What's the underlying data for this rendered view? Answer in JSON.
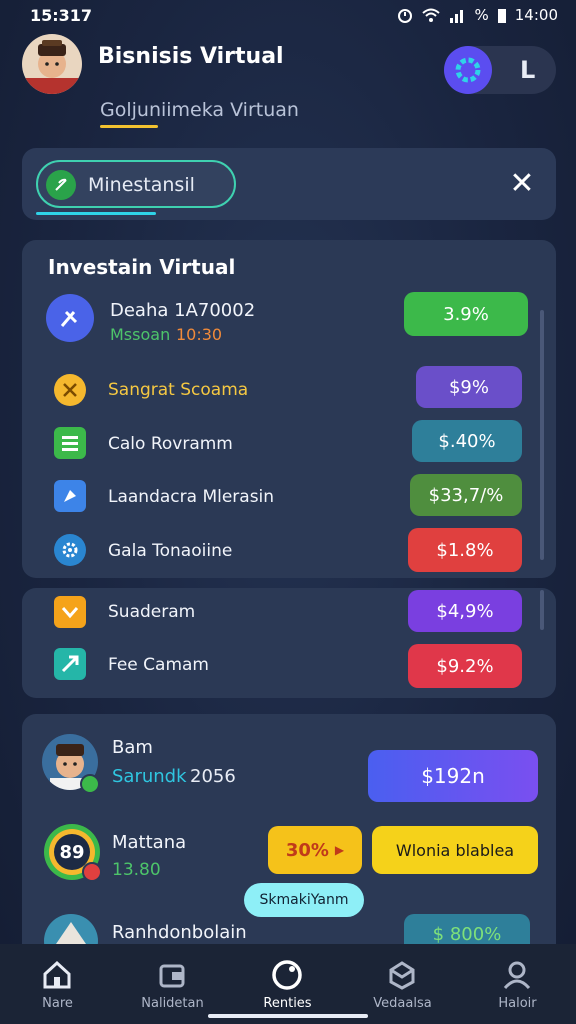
{
  "status_bar": {
    "time": "15:317",
    "battery": "%",
    "clock_right": "14:00"
  },
  "header": {
    "title": "Bisnisis Virtual",
    "subtitle": "Goljuniimeka Virtuan",
    "toggle_label": "L"
  },
  "search": {
    "value": "Minestansil"
  },
  "invest_card": {
    "title": "Investain Virtual",
    "featured": {
      "name": "Deaha 1A70002",
      "sub_label": "Mssoan",
      "sub_value": "10:30",
      "badge": "3.9%",
      "badge_color": "#3cb94a"
    },
    "items": [
      {
        "label": "Sangrat Scoama",
        "value": "$9%",
        "icon": "coin-icon",
        "label_color": "#f5c842",
        "pill_color": "#6a4fc9"
      },
      {
        "label": "Calo Rovramm",
        "value": "$.40%",
        "icon": "list-icon",
        "label_color": "#f1f4fa",
        "pill_color": "#2e7f9a"
      },
      {
        "label": "Laandacra Mlerasin",
        "value": "$33,7/%",
        "icon": "rocket-icon",
        "label_color": "#f1f4fa",
        "pill_color": "#4f8e3e"
      },
      {
        "label": "Gala Tonaoiine",
        "value": "$1.8%",
        "icon": "gear-icon",
        "label_color": "#f1f4fa",
        "pill_color": "#e0403f"
      },
      {
        "label": "Suaderam",
        "value": "$4,9%",
        "icon": "check-icon",
        "label_color": "#f1f4fa",
        "pill_color": "#7a3fe0"
      },
      {
        "label": "Fee Camam",
        "value": "$9.2%",
        "icon": "arrow-icon",
        "label_color": "#f1f4fa",
        "pill_color": "#e0374a"
      }
    ]
  },
  "bottom_list": {
    "items": [
      {
        "title": "Bam",
        "sub_label": "Sarundk",
        "sub_value": "2056",
        "button": "$192n"
      },
      {
        "title": "Mattana",
        "sub_value": "13.80",
        "avatar_text": "89",
        "pct_button": "30%",
        "action_button": "Wlonia blablea"
      },
      {
        "title": "Ranhdonbolain",
        "value": "$ 800%"
      }
    ],
    "tooltip": "SkmakiYanm"
  },
  "nav": {
    "items": [
      {
        "label": "Nare",
        "icon": "home-icon"
      },
      {
        "label": "Nalidetan",
        "icon": "wallet-icon"
      },
      {
        "label": "Renties",
        "icon": "circle-icon"
      },
      {
        "label": "Vedaalsa",
        "icon": "box-icon"
      },
      {
        "label": "Haloir",
        "icon": "user-icon"
      }
    ]
  }
}
